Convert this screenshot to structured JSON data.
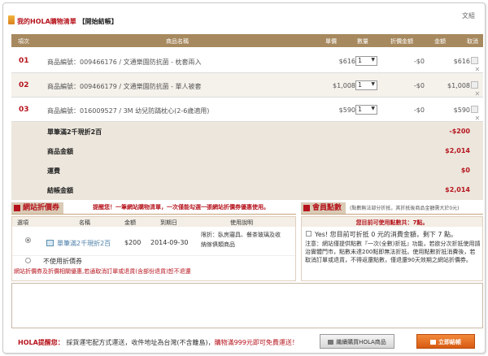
{
  "header": {
    "title_a": "我的HOLA購物清單",
    "title_b": "【開始結帳】",
    "zoom_link": "文組"
  },
  "table": {
    "columns": [
      "項次",
      "商品名稱",
      "單價",
      "數量",
      "折價金額",
      "金額",
      "取消"
    ],
    "rows": [
      {
        "idx": "01",
        "desc": "商品編號：009466176  /  文通樂園防抗菌 - 枕套兩入",
        "price": "$616",
        "qty": "1",
        "disc": "-$0",
        "amount": "$616"
      },
      {
        "idx": "02",
        "desc": "商品編號：009466179  /  文通樂園防抗菌 - 單人被套",
        "price": "$1,008",
        "qty": "1",
        "disc": "-$0",
        "amount": "$1,008"
      },
      {
        "idx": "03",
        "desc": "商品編號：016009527  /  3M 幼兒防蹣枕心(2-6歲適用)",
        "price": "$590",
        "qty": "1",
        "disc": "-$0",
        "amount": "$590"
      }
    ]
  },
  "summary": {
    "promo_label": "單筆滿2千現折2百",
    "promo_value": "-$200",
    "goods_label": "商品金額",
    "goods_value": "$2,014",
    "ship_label": "運費",
    "ship_value": "$0",
    "total_label": "結帳金額",
    "total_value": "$2,014"
  },
  "coupon": {
    "tag": "網站折價券",
    "note": "提醒您！一筆網站購物清單，一次僅能勾選一張網站折價券優惠使用。",
    "cols": [
      "選項",
      "名稱",
      "金額",
      "到期日",
      "使用說明"
    ],
    "item_name": "單筆滿2千現折2百",
    "item_amount": "$200",
    "item_expire": "2014-09-30",
    "item_desc1": "限折：臥房寢具、餐茶玻璃及收",
    "item_desc2": "納傢俱類商品",
    "no_use": "不使用折價券",
    "footer": "網站折價券及折價相關優惠,若通取消訂單或退貨(含部份退貨)恕不退還"
  },
  "points": {
    "tag": "會員點數",
    "note": "(點數無法部分折抵，其折抵後商品金額需大於0元)",
    "available": "您目前可使用點數共：7點。",
    "option": "Yes! 您目前可折抵 0 元的消費金額，剩下 7 點。",
    "notice": "注意：網站僅提供點數『一次(全數)折抵』功能，若欲分次折抵使用請治實體門市，點數未達200點即無法折抵。使用點數折抵消費後，若取消訂單或退貨，不得返還點數，僅退還90天效期之網站折價券。"
  },
  "footer": {
    "remind_label": "HOLA提醒您：",
    "remind_text": "採貨運宅配方式運送，收件地址為台灣(不含離島)，",
    "remind_highlight": "購物滿999元即可免費運送！",
    "continue_label": "繼續購買HOLA商品",
    "checkout_label": "立即結帳"
  }
}
